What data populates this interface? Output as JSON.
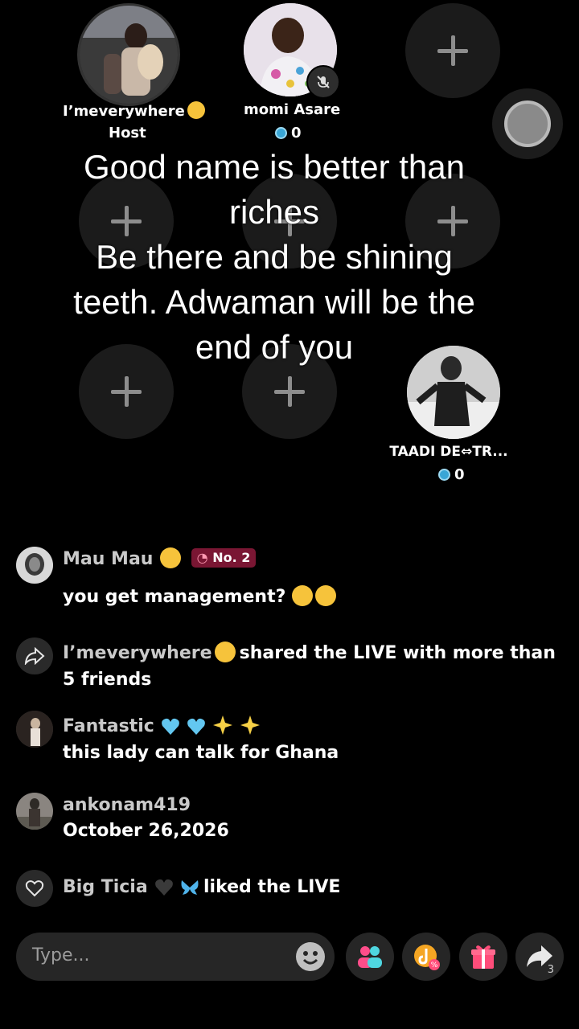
{
  "seats": {
    "host": {
      "name": "I’meverywhere",
      "role": "Host"
    },
    "guest1": {
      "name": "momi Asare",
      "coins": "0"
    },
    "guest2": {
      "name": "TAADI DE⇔TR...",
      "coins": "0"
    }
  },
  "caption": {
    "line1": "Good name is better than",
    "line2": "riches",
    "line3": "Be there and be shining",
    "line4": "teeth. Adwaman will be the",
    "line5": "end of you"
  },
  "chat": [
    {
      "user": "Mau Mau",
      "badge": "No. 2",
      "text": "you get management?"
    },
    {
      "user": "I’meverywhere",
      "text": "shared the LIVE with more than 5 friends"
    },
    {
      "user": "Fantastic",
      "text": "this lady can talk for Ghana"
    },
    {
      "user": "ankonam419",
      "text": "October 26,2026"
    },
    {
      "user": "Big Ticia",
      "text": "liked the LIVE"
    }
  ],
  "input": {
    "placeholder": "Type..."
  },
  "share_count": "3",
  "icons": [
    "plus-icon",
    "mute-mic-icon",
    "share-arrow-icon",
    "heart-icon",
    "smiley-icon",
    "guests-icon",
    "tiktok-coupon-icon",
    "gift-icon",
    "share-icon"
  ],
  "colors": {
    "background": "#000000",
    "badge": "#7a1633",
    "gem": "#39a6d6",
    "gift": "#ff4d7a"
  }
}
